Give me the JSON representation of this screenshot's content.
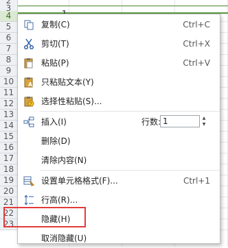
{
  "sheet": {
    "row_numbers": [
      "2",
      "3",
      "4",
      "5",
      "6",
      "7",
      "8",
      "9",
      "10",
      "11",
      "12",
      "13",
      "14",
      "15",
      "16",
      "17",
      "18",
      "19",
      "20",
      "21",
      "22",
      "23"
    ],
    "selected_row": "4",
    "cell_value": "1"
  },
  "menu": {
    "copy": {
      "label": "复制(C)",
      "shortcut": "Ctrl+C"
    },
    "cut": {
      "label": "剪切(T)",
      "shortcut": "Ctrl+X"
    },
    "paste": {
      "label": "粘贴(P)",
      "shortcut": "Ctrl+V"
    },
    "paste_text": {
      "label": "只粘贴文本(Y)"
    },
    "paste_special": {
      "label": "选择性粘贴(S)..."
    },
    "insert": {
      "label": "插入(I)",
      "row_count_label": "行数:",
      "row_count_value": "1"
    },
    "delete": {
      "label": "删除(D)"
    },
    "clear": {
      "label": "清除内容(N)"
    },
    "format_cells": {
      "label": "设置单元格格式(F)...",
      "shortcut": "Ctrl+1"
    },
    "row_height": {
      "label": "行高(R)..."
    },
    "hide": {
      "label": "隐藏(H)"
    },
    "unhide": {
      "label": "取消隐藏(U)"
    }
  },
  "colors": {
    "selection": "#5b9a3e",
    "highlight": "#e23a3a"
  }
}
